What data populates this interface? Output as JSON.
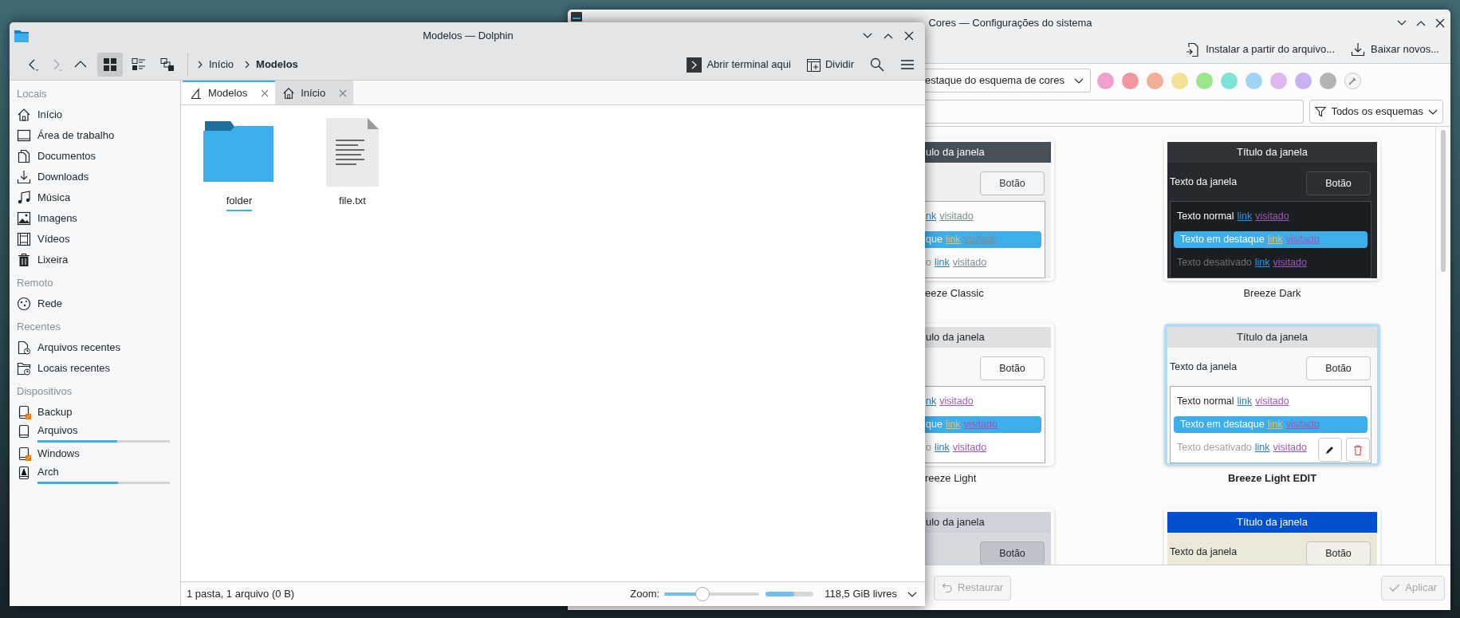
{
  "dolphin": {
    "title": "Modelos — Dolphin",
    "nav_buttons": [
      {
        "kind": "back",
        "disabled": false
      },
      {
        "kind": "forward",
        "disabled": true
      },
      {
        "kind": "up",
        "disabled": false
      }
    ],
    "view_modes": [
      {
        "kind": "icons",
        "selected": true
      },
      {
        "kind": "compact",
        "selected": false
      },
      {
        "kind": "details",
        "selected": false
      }
    ],
    "breadcrumb": [
      {
        "label": "Início",
        "current": false
      },
      {
        "label": "Modelos",
        "current": true
      }
    ],
    "toolbar_actions": [
      {
        "kind": "terminal",
        "label": "Abrir terminal aqui"
      },
      {
        "kind": "split",
        "label": "Dividir"
      },
      {
        "kind": "search"
      },
      {
        "kind": "menu"
      }
    ],
    "sidebar": [
      {
        "header": "Locais",
        "items": [
          {
            "kind": "home",
            "label": "Início"
          },
          {
            "kind": "desktop",
            "label": "Área de trabalho"
          },
          {
            "kind": "documents",
            "label": "Documentos"
          },
          {
            "kind": "downloads",
            "label": "Downloads"
          },
          {
            "kind": "music",
            "label": "Música"
          },
          {
            "kind": "pictures",
            "label": "Imagens"
          },
          {
            "kind": "videos",
            "label": "Vídeos"
          },
          {
            "kind": "trash",
            "label": "Lixeira"
          }
        ]
      },
      {
        "header": "Remoto",
        "items": [
          {
            "kind": "network",
            "label": "Rede"
          }
        ]
      },
      {
        "header": "Recentes",
        "items": [
          {
            "kind": "recentfiles",
            "label": "Arquivos recentes"
          },
          {
            "kind": "recentplaces",
            "label": "Locais recentes"
          }
        ]
      },
      {
        "header": "Dispositivos",
        "items": [
          {
            "kind": "drive",
            "label": "Backup",
            "mounted": false
          },
          {
            "kind": "drive",
            "label": "Arquivos",
            "mounted": true,
            "level": 0.6
          },
          {
            "kind": "drive",
            "label": "Windows",
            "mounted": false
          },
          {
            "kind": "archdrive",
            "label": "Arch",
            "mounted": true,
            "level": 0.61
          }
        ]
      }
    ],
    "tabs": [
      {
        "kind": "templates",
        "label": "Modelos",
        "selected": true
      },
      {
        "kind": "home",
        "label": "Início",
        "selected": false
      }
    ],
    "files": [
      {
        "kind": "folder",
        "name": "folder",
        "focused": true
      },
      {
        "kind": "text",
        "name": "file.txt",
        "focused": false
      }
    ],
    "status": "1 pasta, 1 arquivo (0 B)",
    "zoom": {
      "label": "Zoom:",
      "level": 0.4
    },
    "free_space": {
      "level": 0.6,
      "text": "118,5 GiB livres"
    }
  },
  "settings": {
    "title": "Cores — Configurações do sistema",
    "toolbar_actions": [
      {
        "kind": "install",
        "label": "Instalar a partir do arquivo..."
      },
      {
        "kind": "download",
        "label": "Baixar novos..."
      }
    ],
    "accent_dropdown": "estaque do esquema de cores",
    "swatches": [
      {
        "color": "#f29fcb"
      },
      {
        "color": "#f0979f"
      },
      {
        "color": "#f2ae94"
      },
      {
        "color": "#f2e297"
      },
      {
        "color": "#9ce68c"
      },
      {
        "color": "#7fe3d7"
      },
      {
        "color": "#9fd5f3"
      },
      {
        "color": "#dcb8ec"
      },
      {
        "color": "#c7b3f0"
      },
      {
        "color": "#b4b4b4"
      }
    ],
    "filter_dropdown": "Todos os esquemas",
    "schemes": [
      {
        "kind": "classic",
        "name": "eeze Classic",
        "selected": false,
        "title": "ulo da janela",
        "button": "Botão",
        "rows": [
          {
            "kind": "normal",
            "link": "nk",
            "visited": "visitado"
          },
          {
            "kind": "highlight",
            "text": "que",
            "link": "link",
            "visited": "visitado"
          },
          {
            "kind": "disabled",
            "text": "o",
            "link": "link",
            "visited": "visitado"
          }
        ]
      },
      {
        "kind": "dark",
        "name": "Breeze Dark",
        "selected": false,
        "title": "Título da janela",
        "window_text": "Texto da janela",
        "button": "Botão",
        "rows": [
          {
            "kind": "normal",
            "text": "Texto normal",
            "link": "link",
            "visited": "visitado"
          },
          {
            "kind": "highlight",
            "text": "Texto em destaque",
            "link": "link",
            "visited": "visitado"
          },
          {
            "kind": "disabled",
            "text": "Texto desativado",
            "link": "link",
            "visited": "visitado"
          }
        ]
      },
      {
        "kind": "light",
        "name": "reeze Light",
        "selected": false,
        "title": "ulo da janela",
        "button": "Botão",
        "rows": [
          {
            "kind": "normal",
            "link": "nk",
            "visited": "visitado"
          },
          {
            "kind": "highlight",
            "text": "que",
            "link": "link",
            "visited": "visitado"
          },
          {
            "kind": "disabled",
            "text": "o",
            "link": "link",
            "visited": "visitado"
          }
        ]
      },
      {
        "kind": "light",
        "name": "Breeze Light EDIT",
        "selected": true,
        "title": "Título da janela",
        "window_text": "Texto da janela",
        "button": "Botão",
        "rows": [
          {
            "kind": "normal",
            "text": "Texto normal",
            "link": "link",
            "visited": "visitado"
          },
          {
            "kind": "highlight",
            "text": "Texto em destaque",
            "link": "link",
            "visited": "visitado"
          },
          {
            "kind": "disabled",
            "text": "Texto desativado",
            "link": "link",
            "visited": "visitado"
          }
        ]
      },
      {
        "kind": "slate",
        "selected": false,
        "title": "ulo da janela",
        "button": "Botão"
      },
      {
        "kind": "navy",
        "selected": false,
        "title": "Título da janela",
        "window_text": "Texto da janela",
        "button": "Botão"
      }
    ],
    "footer_buttons": [
      {
        "kind": "reset",
        "label": "Restaurar",
        "disabled": true
      },
      {
        "kind": "apply",
        "label": "Aplicar",
        "disabled": true
      }
    ]
  }
}
